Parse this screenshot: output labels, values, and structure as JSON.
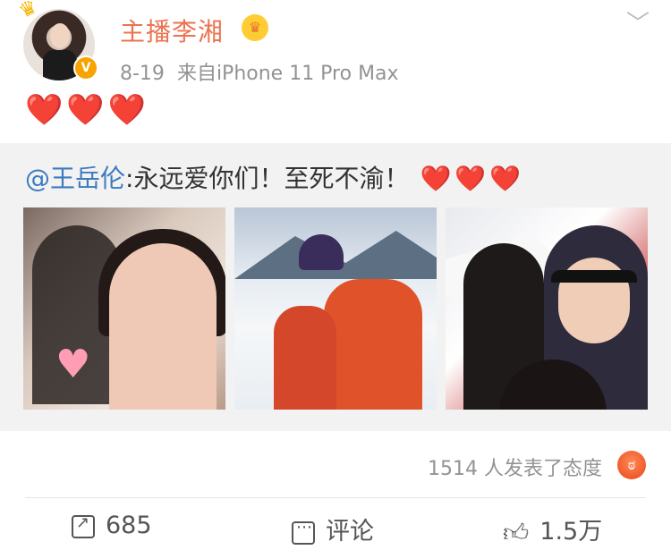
{
  "post": {
    "username": "主播李湘",
    "date": "8-19",
    "source": "来自iPhone 11 Pro Max",
    "hearts": "❤️❤️❤️",
    "verified_badge": "V",
    "icons": {
      "crown": "crown-icon",
      "verified": "verified-badge-icon",
      "more": "chevron-down-icon"
    }
  },
  "repost": {
    "mention": "@王岳伦",
    "text": ":永远爱你们！至死不渝！",
    "hearts": "❤️❤️❤️",
    "photos": [
      "photo-couple-selfie",
      "photo-family-ski",
      "photo-family-boat"
    ]
  },
  "reactions": {
    "text": "1514 人发表了态度",
    "emoji": "angry-face-icon"
  },
  "actions": {
    "share_count": "685",
    "comment_label": "评论",
    "like_count": "1.5万"
  }
}
